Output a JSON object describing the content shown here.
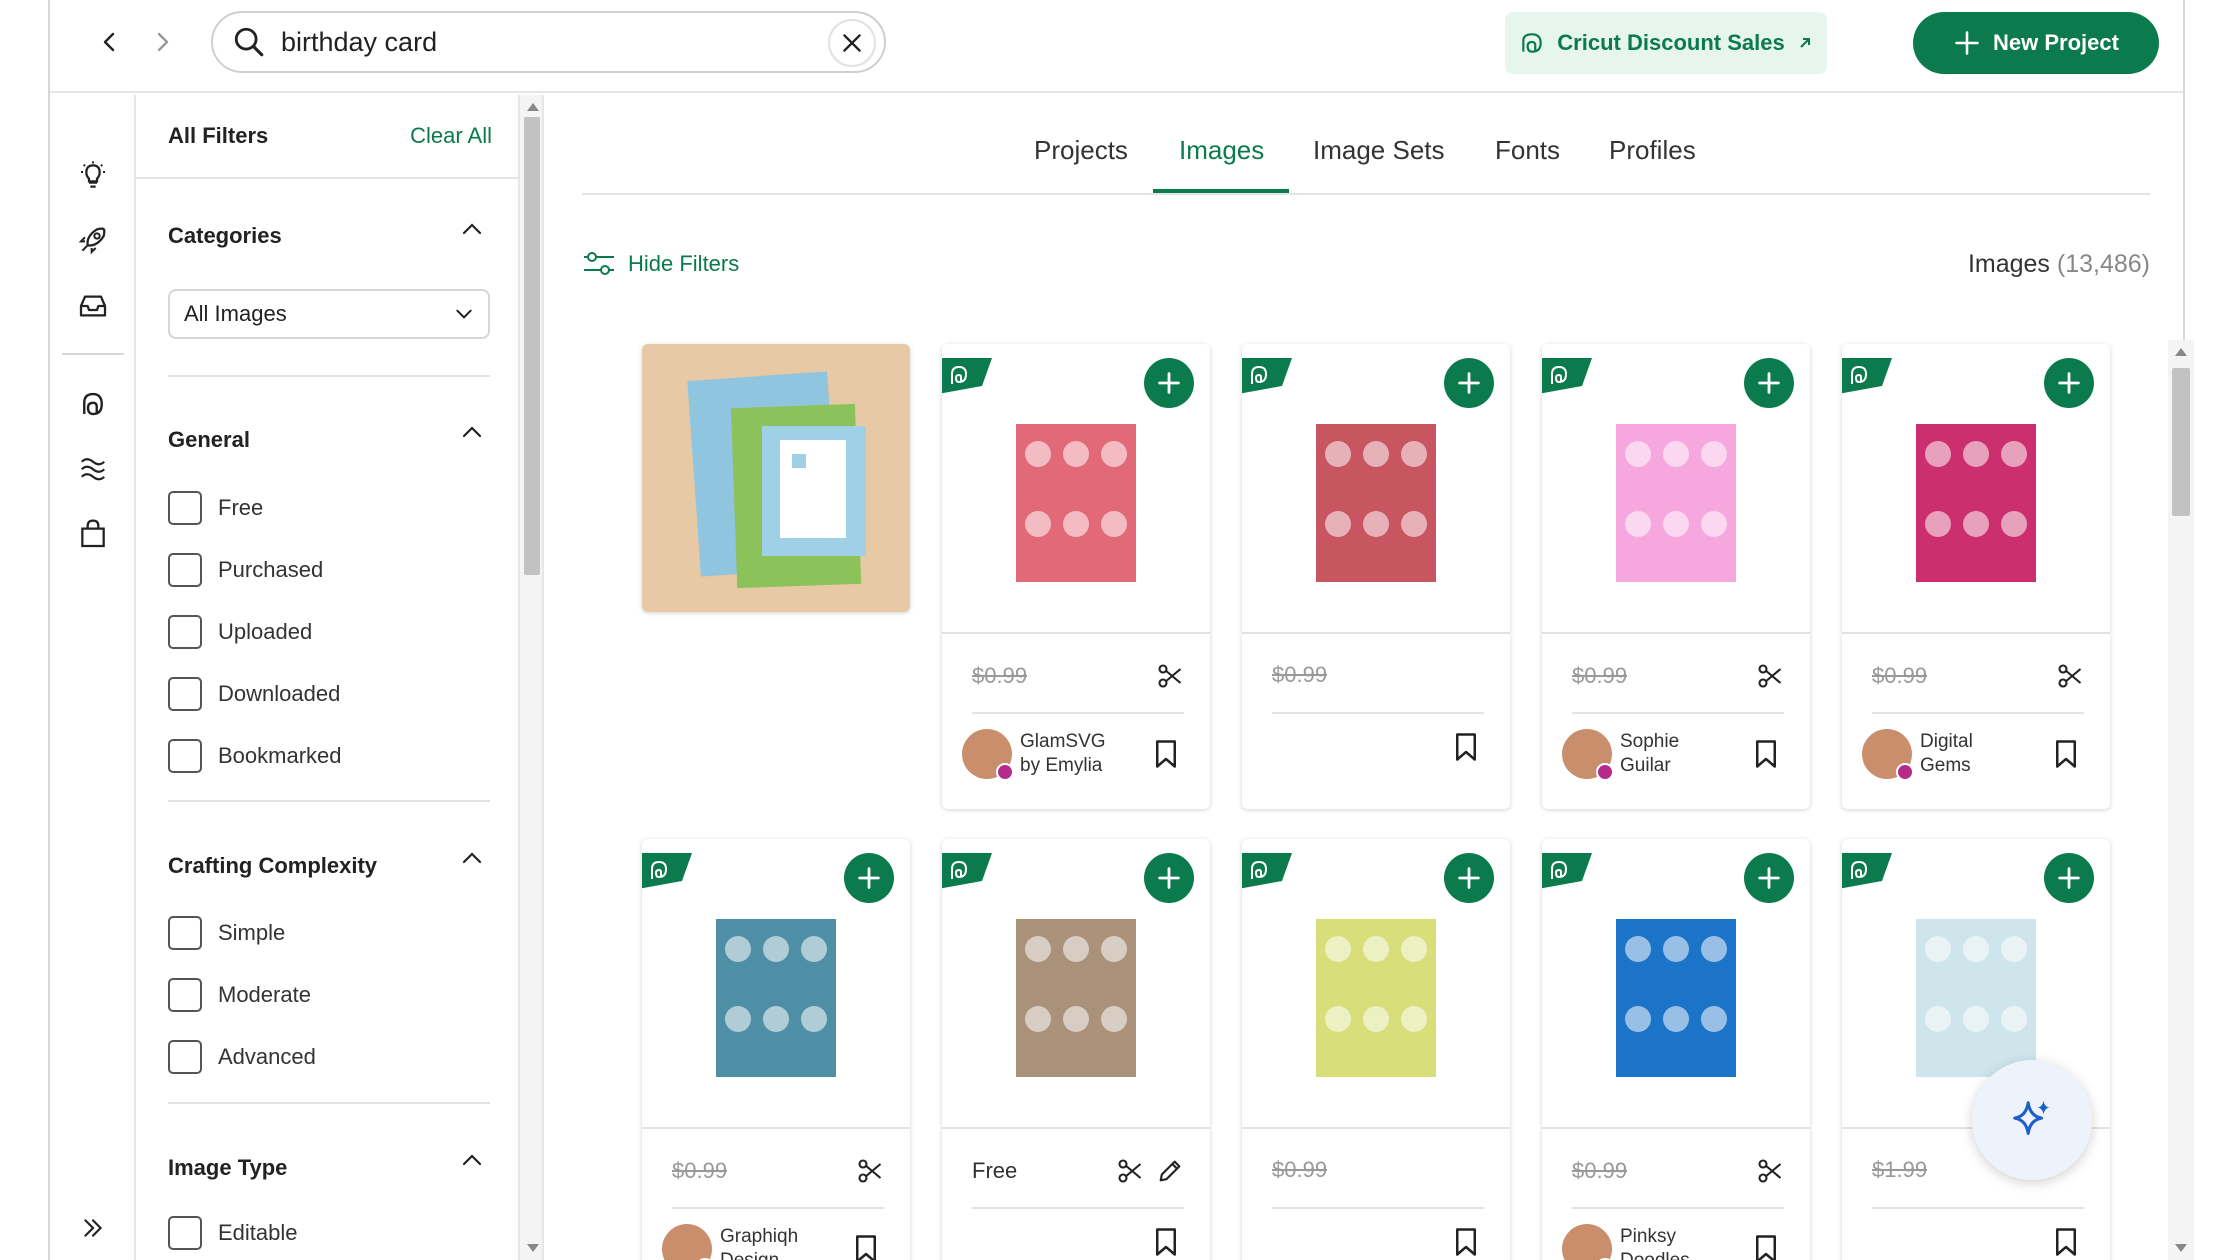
{
  "search": {
    "query": "birthday card"
  },
  "header": {
    "discount_label": "Cricut Discount Sales",
    "new_project_label": "New Project"
  },
  "colors": {
    "brand": "#0b7a4d",
    "brand_light": "#e7f5ef"
  },
  "rail": {
    "icons": [
      "lightbulb-icon",
      "rocket-icon",
      "inbox-icon",
      "cricut-access-icon",
      "waves-icon",
      "shopping-bag-icon",
      "expand-icon"
    ]
  },
  "filters": {
    "title": "All Filters",
    "clear_label": "Clear All",
    "categories": {
      "title": "Categories",
      "selected": "All Images"
    },
    "general": {
      "title": "General",
      "options": [
        "Free",
        "Purchased",
        "Uploaded",
        "Downloaded",
        "Bookmarked"
      ]
    },
    "complexity": {
      "title": "Crafting Complexity",
      "options": [
        "Simple",
        "Moderate",
        "Advanced"
      ]
    },
    "image_type": {
      "title": "Image Type",
      "options": [
        "Editable"
      ]
    }
  },
  "tabs": [
    "Projects",
    "Images",
    "Image Sets",
    "Fonts",
    "Profiles"
  ],
  "active_tab": "Images",
  "toolbar": {
    "hide_filters_label": "Hide Filters"
  },
  "results": {
    "label": "Images",
    "count": "(13,486)"
  },
  "cards_row1": [
    {
      "price": "$0.99",
      "author": [
        "GlamSVG",
        "by Emylia"
      ],
      "color": "#e26a78",
      "tool": "scissors"
    },
    {
      "price": "$0.99",
      "author": [],
      "color": "#c85660",
      "tool": ""
    },
    {
      "price": "$0.99",
      "author": [
        "Sophie",
        "Guilar"
      ],
      "color": "#f6a7dd",
      "tool": "scissors"
    },
    {
      "price": "$0.99",
      "author": [
        "Digital",
        "Gems"
      ],
      "color": "#cc2f6e",
      "tool": "scissors"
    }
  ],
  "cards_row2": [
    {
      "price": "$0.99",
      "author": [
        "Graphiqh",
        "Design"
      ],
      "color": "#4f8fa6",
      "tool": "scissors"
    },
    {
      "price": "Free",
      "author": [],
      "color": "#a9917a",
      "tool": "scissors-pen"
    },
    {
      "price": "$0.99",
      "author": [],
      "color": "#d7de7a",
      "tool": ""
    },
    {
      "price": "$0.99",
      "author": [
        "Pinksy",
        "Doodles"
      ],
      "color": "#1c74c8",
      "tool": "scissors"
    },
    {
      "price": "$1.99",
      "author": [],
      "color": "#cfe5ec",
      "tool": ""
    }
  ]
}
